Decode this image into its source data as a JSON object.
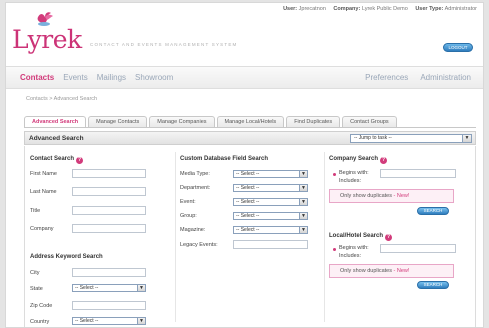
{
  "header": {
    "user_label": "User:",
    "user_value": "Jprecatnon",
    "company_label": "Company:",
    "company_value": "Lyrek Public Demo",
    "user_type_label": "User Type:",
    "user_type_value": "Administrator",
    "logo_text": "Lyrek",
    "tagline": "CONTACT AND EVENTS MANAGEMENT SYSTEM",
    "logout_label": "LOGOUT",
    "brand_color": "#cc3377"
  },
  "nav": {
    "left": [
      "Contacts",
      "Events",
      "Mailings",
      "Showroom"
    ],
    "right": [
      "Preferences",
      "Administration"
    ],
    "active": "Contacts"
  },
  "breadcrumb": "Contacts > Advanced Search",
  "tabs": [
    "Advanced Search",
    "Manage Contacts",
    "Manage Companies",
    "Manage Local/Hotels",
    "Find Duplicates",
    "Contact Groups"
  ],
  "panel": {
    "title": "Advanced Search",
    "jump_select": "-- Jump to task --"
  },
  "contact_search": {
    "heading": "Contact Search",
    "fields": [
      "First Name",
      "Last Name",
      "Title",
      "Company"
    ]
  },
  "address_search": {
    "heading": "Address Keyword Search",
    "city_label": "City",
    "state_label": "State",
    "state_value": "-- Select --",
    "zip_label": "Zip Code",
    "country_label": "Country",
    "country_value": "-- Select --"
  },
  "custom_search": {
    "heading": "Custom Database Field Search",
    "rows": [
      {
        "label": "Media Type:",
        "value": "-- Select --"
      },
      {
        "label": "Department:",
        "value": "-- Select --"
      },
      {
        "label": "Event:",
        "value": "-- Select --"
      },
      {
        "label": "Group:",
        "value": "-- Select --"
      },
      {
        "label": "Magazine:",
        "value": "-- Select --"
      }
    ],
    "legacy_label": "Legacy Events:"
  },
  "company_search": {
    "heading": "Company Search",
    "begins_with": "Begins with:",
    "includes": "Includes:",
    "dup_text": "Only show duplicates",
    "dup_new": "- New!",
    "button": "SEARCH"
  },
  "local_search": {
    "heading": "Local/Hotel Search",
    "begins_with": "Begins with:",
    "includes": "Includes:",
    "dup_text": "Only show duplicates",
    "dup_new": "- New!",
    "button": "SEARCH"
  }
}
